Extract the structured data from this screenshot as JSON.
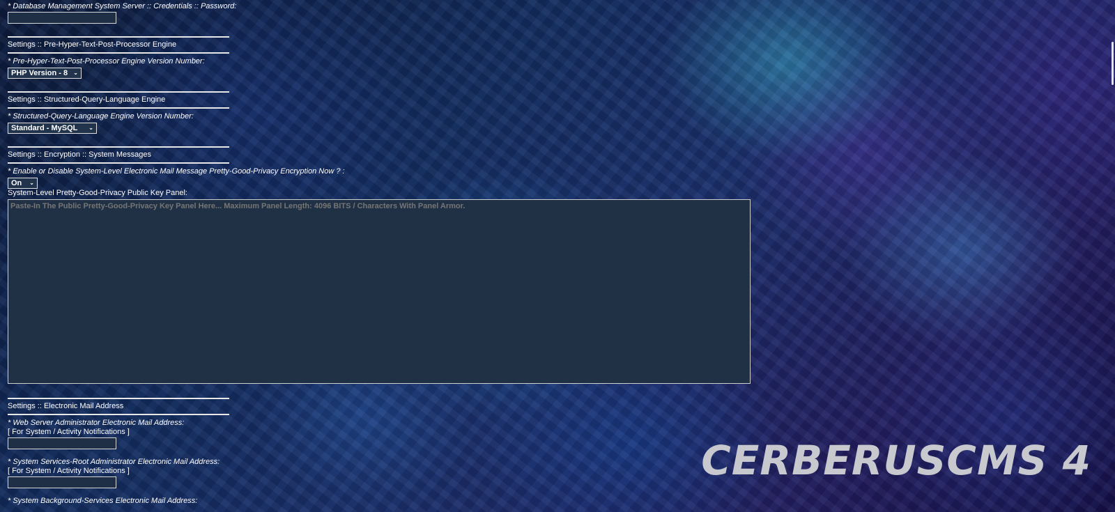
{
  "db_password": {
    "label": "* Database Management System Server :: Credentials :: Password:",
    "value": ""
  },
  "php_section": {
    "title": "Settings :: Pre-Hyper-Text-Post-Processor Engine",
    "field_label": "* Pre-Hyper-Text-Post-Processor Engine Version Number:",
    "selected": "PHP Version - 8"
  },
  "sql_section": {
    "title": "Settings :: Structured-Query-Language Engine",
    "field_label": "* Structured-Query-Language Engine Version Number:",
    "selected": "Standard - MySQL"
  },
  "encryption_section": {
    "title": "Settings :: Encryption :: System Messages",
    "toggle_label": "* Enable or Disable System-Level Electronic Mail Message Pretty-Good-Privacy Encryption Now ? :",
    "toggle_selected": "On",
    "key_panel_label": "System-Level Pretty-Good-Privacy Public Key Panel:",
    "key_panel_placeholder": "Paste-In The Public Pretty-Good-Privacy Key Panel Here... Maximum Panel Length: 4096 BITS / Characters With Panel Armor."
  },
  "email_section": {
    "title": "Settings :: Electronic Mail Address",
    "web_admin_label": "* Web Server Administrator Electronic Mail Address:",
    "web_admin_note": "[ For System / Activity Notifications ]",
    "root_admin_label": "* System Services-Root Administrator Electronic Mail Address:",
    "root_admin_note": "[ For System / Activity Notifications ]",
    "background_label": "* System Background-Services Electronic Mail Address:"
  },
  "brand": {
    "text": "CERBERUSCMS 4"
  },
  "icons": {
    "dropdown": "chevron-down-icon"
  }
}
